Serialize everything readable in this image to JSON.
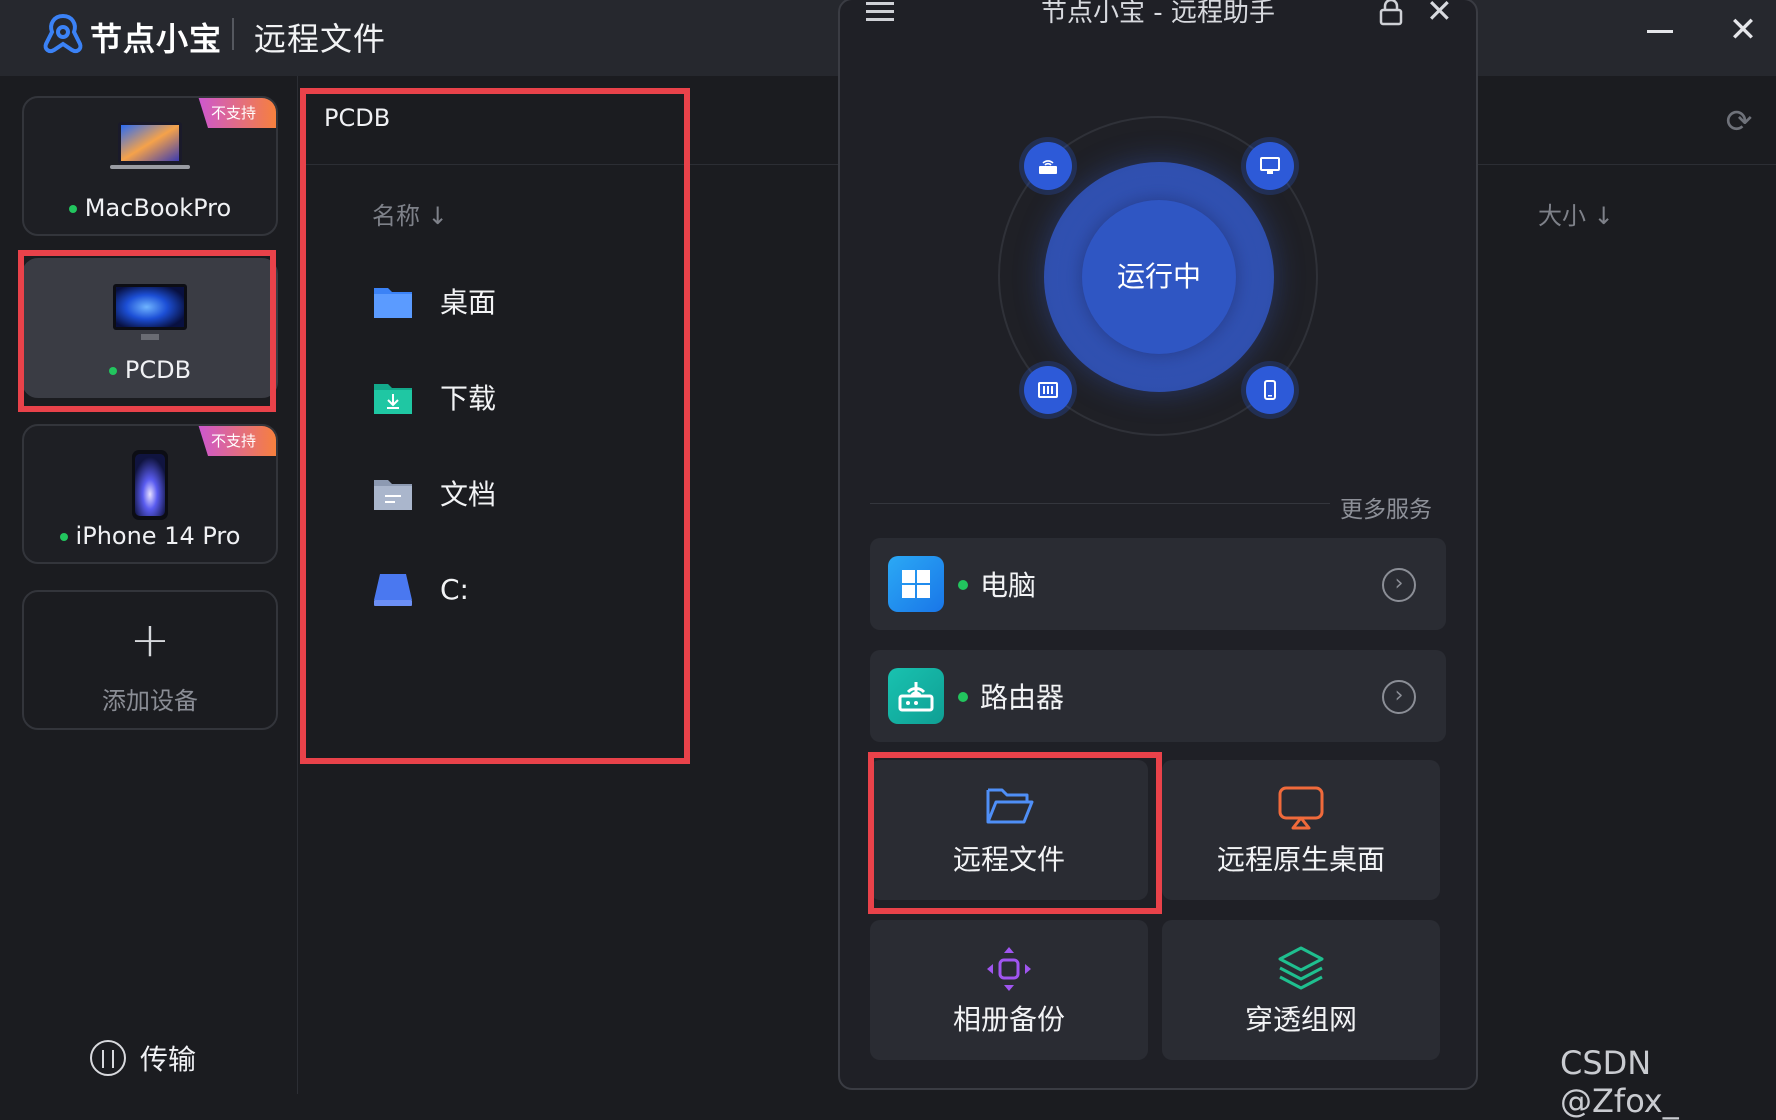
{
  "window": {
    "brand": "节点小宝",
    "title": "远程文件"
  },
  "sidebar": {
    "devices": [
      {
        "name": "MacBookPro",
        "badge": "不支持"
      },
      {
        "name": "PCDB",
        "badge": ""
      },
      {
        "name": "iPhone 14 Pro",
        "badge": "不支持"
      }
    ],
    "add_device_label": "添加设备",
    "transfer_label": "传输"
  },
  "files": {
    "path": "PCDB",
    "col_name": "名称 ↓",
    "col_size": "大小 ↓",
    "items": [
      {
        "name": "桌面"
      },
      {
        "name": "下载"
      },
      {
        "name": "文档"
      },
      {
        "name": "C:"
      }
    ]
  },
  "assistant": {
    "title": "节点小宝 - 远程助手",
    "status": "运行中",
    "more_services": "更多服务",
    "services": [
      {
        "label": "电脑"
      },
      {
        "label": "路由器"
      }
    ],
    "tiles": [
      {
        "label": "远程文件"
      },
      {
        "label": "远程原生桌面"
      },
      {
        "label": "相册备份"
      },
      {
        "label": "穿透组网"
      }
    ]
  },
  "watermark": "CSDN @Zfox_"
}
